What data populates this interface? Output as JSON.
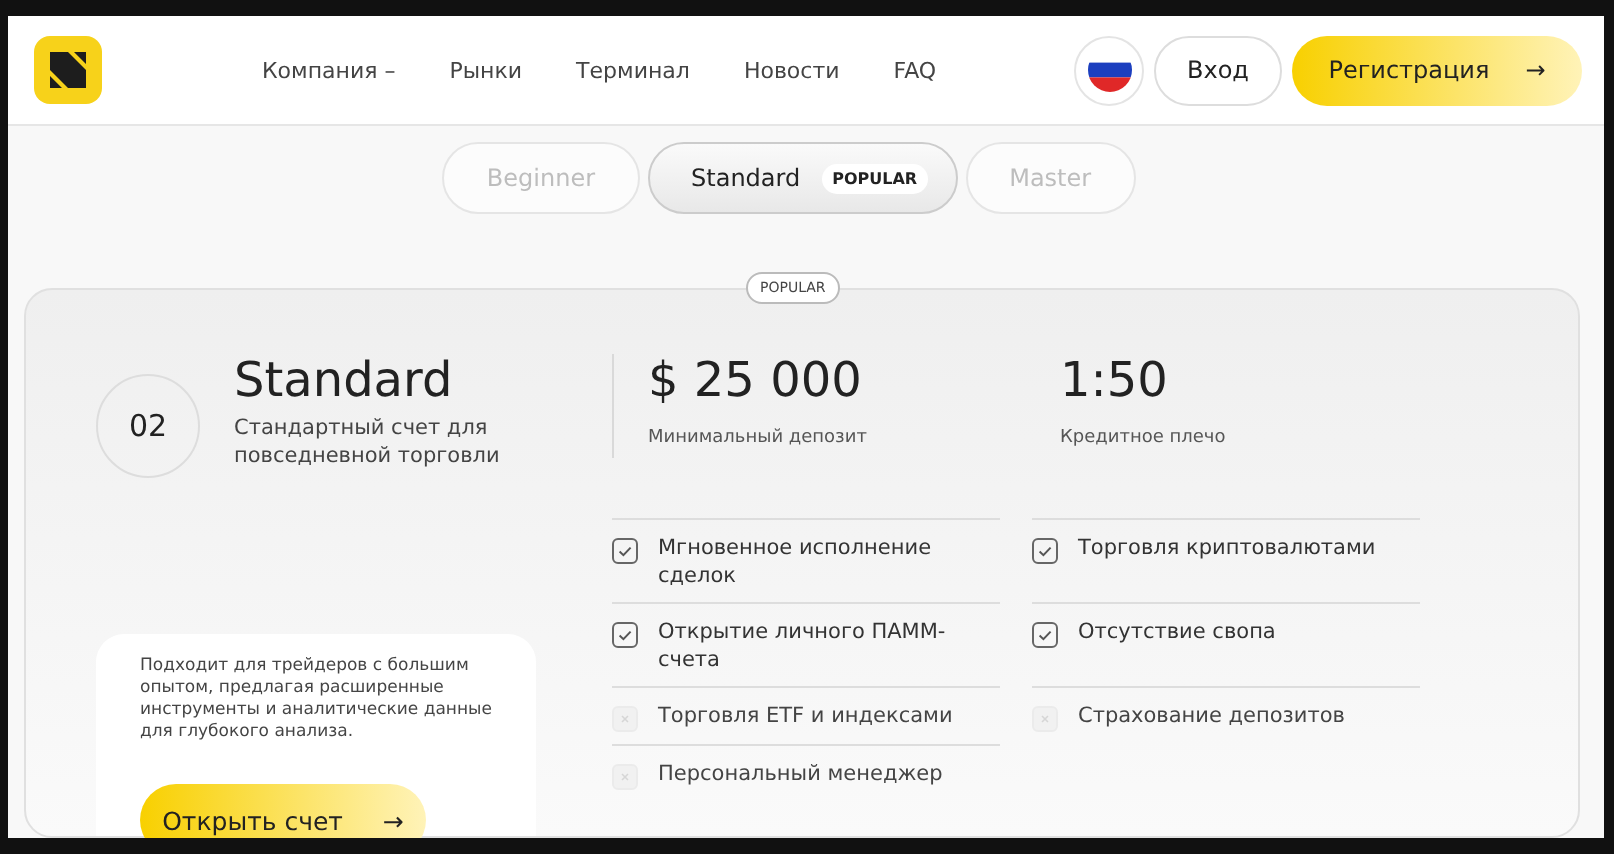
{
  "header": {
    "nav": [
      {
        "label": "Компания –"
      },
      {
        "label": "Рынки"
      },
      {
        "label": "Терминал"
      },
      {
        "label": "Новости"
      },
      {
        "label": "FAQ"
      }
    ],
    "login": "Вход",
    "register": {
      "label": "Регистрация",
      "arrow": "→"
    }
  },
  "plan_tabs": [
    {
      "label": "Beginner",
      "selected": false
    },
    {
      "label": "Standard",
      "badge": "POPULAR",
      "selected": true
    },
    {
      "label": "Master",
      "selected": false
    }
  ],
  "plan": {
    "badge": "POPULAR",
    "number": "02",
    "name": "Standard",
    "description": "Стандартный счет для повседневной торговли",
    "stats": [
      {
        "value": "$ 25 000",
        "label": "Минимальный депозит"
      },
      {
        "value": "1:50",
        "label": "Кредитное плечо"
      }
    ],
    "features": [
      {
        "label": "Мгновенное исполнение сделок",
        "included": true
      },
      {
        "label": "Торговля криптовалютами",
        "included": true
      },
      {
        "label": "Открытие личного ПАММ-счета",
        "included": true
      },
      {
        "label": "Отсутствие свопа",
        "included": true
      },
      {
        "label": "Торговля ETF и индексами",
        "included": false
      },
      {
        "label": "Страхование депозитов",
        "included": false
      },
      {
        "label": "Персональный менеджер",
        "included": false
      }
    ],
    "summary": {
      "text": "Подходит для трейдеров с большим опытом, предлагая расширенные инструменты и аналитические данные для глубокого анализа.",
      "button": {
        "label": "Открыть счет",
        "arrow": "→"
      }
    }
  }
}
